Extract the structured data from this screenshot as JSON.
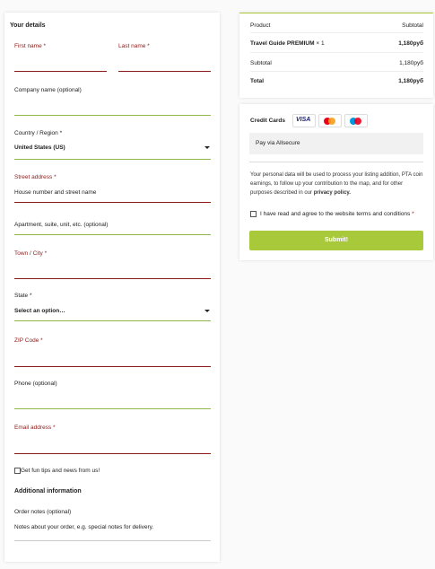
{
  "billing": {
    "heading": "Your details",
    "first_name_label": "First name",
    "last_name_label": "Last name",
    "required_mark": "*",
    "company_label": "Company name (optional)",
    "country_label": "Country / Region",
    "country_value": "United States (US)",
    "street_label": "Street address",
    "street_placeholder": "House number and street name",
    "apartment_placeholder": "Apartment, suite, unit, etc. (optional)",
    "town_label": "Town / City",
    "state_label": "State",
    "state_value": "Select an option…",
    "zip_label": "ZIP Code",
    "phone_label": "Phone (optional)",
    "email_label": "Email address",
    "newsletter_label": "Get fun tips and news from us!"
  },
  "additional": {
    "heading": "Additional information",
    "notes_label": "Order notes (optional)",
    "notes_placeholder": "Notes about your order, e.g. special notes for delivery."
  },
  "summary": {
    "col_product": "Product",
    "col_subtotal": "Subtotal",
    "item_name": "Travel Guide PREMIUM",
    "item_qty": "× 1",
    "item_price": "1,180руб",
    "subtotal_label": "Subtotal",
    "subtotal_value": "1,180руб",
    "total_label": "Total",
    "total_value": "1,180руб"
  },
  "payment": {
    "method_label": "Credit Cards",
    "visa": "VISA",
    "provider_text": "Pay via Allsecure",
    "privacy_text": "Your personal data will be used to process your listing addition, PTA coin earnings, to follow up your contribution to the map, and for other purposes described in our",
    "privacy_link": "privacy policy.",
    "terms_label": "I have read and agree to the website terms and conditions",
    "submit_label": "Submit!",
    "colors": {
      "accent": "#a8c93a",
      "error": "#8b1a1a",
      "valid": "#8fb84a"
    }
  }
}
